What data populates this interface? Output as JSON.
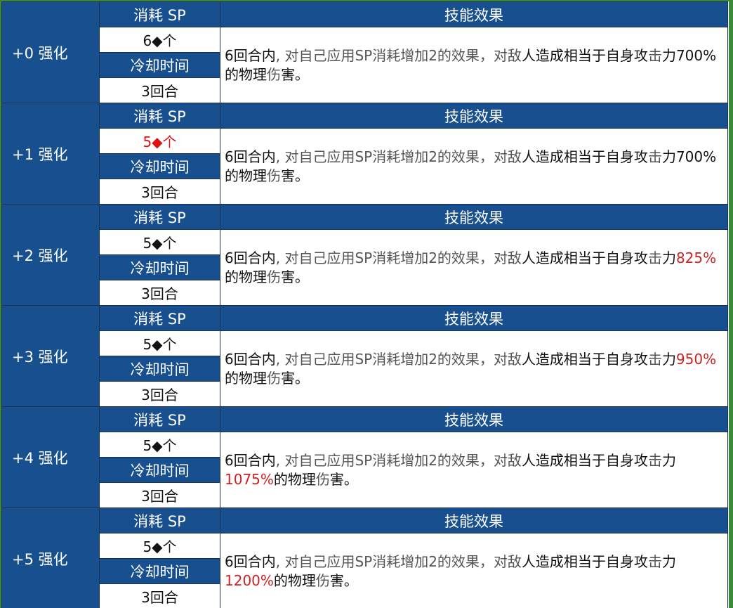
{
  "labels": {
    "sp_cost": "消耗 SP",
    "skill_effect": "技能效果",
    "cooldown": "冷却时间"
  },
  "colors": {
    "header_blue": "#18508f",
    "highlight_red": "#dd1111"
  },
  "rows": [
    {
      "level": "+0 强化",
      "sp": "6◆个",
      "sp_changed": false,
      "cooldown": "3回合",
      "effect": {
        "a": "6回合内",
        "b": ", 对自己应用SP消耗增加2的效果，",
        "c": "对敌",
        "d": "人造成相当于自身攻",
        "e": "击",
        "f": "力",
        "value": "700%",
        "value_changed": false,
        "g": "的物理",
        "h": "伤",
        "i": "害。"
      }
    },
    {
      "level": "+1 强化",
      "sp": "5◆个",
      "sp_changed": true,
      "cooldown": "3回合",
      "effect": {
        "a": "6回合内",
        "b": ", 对自己应用SP消耗增加2的效果，",
        "c": "对敌",
        "d": "人造成相当于自身攻",
        "e": "击",
        "f": "力",
        "value": "700%",
        "value_changed": false,
        "g": "的物理",
        "h": "伤",
        "i": "害。"
      }
    },
    {
      "level": "+2 强化",
      "sp": "5◆个",
      "sp_changed": false,
      "cooldown": "3回合",
      "effect": {
        "a": "6回合内",
        "b": ", 对自己应用SP消耗增加2的效果，",
        "c": "对敌",
        "d": "人造成相当于自身攻",
        "e": "击",
        "f": "力",
        "value": "825%",
        "value_changed": true,
        "g": "的物理",
        "h": "伤",
        "i": "害。"
      }
    },
    {
      "level": "+3 强化",
      "sp": "5◆个",
      "sp_changed": false,
      "cooldown": "3回合",
      "effect": {
        "a": "6回合内",
        "b": ", 对自己应用SP消耗增加2的效果，",
        "c": "对敌",
        "d": "人造成相当于自身攻",
        "e": "击",
        "f": "力",
        "value": "950%",
        "value_changed": true,
        "g": "的物理",
        "h": "伤",
        "i": "害。"
      }
    },
    {
      "level": "+4 强化",
      "sp": "5◆个",
      "sp_changed": false,
      "cooldown": "3回合",
      "effect": {
        "a": "6回合内",
        "b": ", 对自己应用SP消耗增加2的效果，",
        "c": "对敌",
        "d": "人造成相当于自身攻",
        "e": "击",
        "f": "力",
        "value": "1075%",
        "value_changed": true,
        "g": "的物理",
        "h": "伤",
        "i": "害。"
      }
    },
    {
      "level": "+5 强化",
      "sp": "5◆个",
      "sp_changed": false,
      "cooldown": "3回合",
      "effect": {
        "a": "6回合内",
        "b": ", 对自己应用SP消耗增加2的效果，",
        "c": "对敌",
        "d": "人造成相当于自身攻",
        "e": "击",
        "f": "力",
        "value": "1200%",
        "value_changed": true,
        "g": "的物理",
        "h": "伤",
        "i": "害。"
      }
    }
  ]
}
